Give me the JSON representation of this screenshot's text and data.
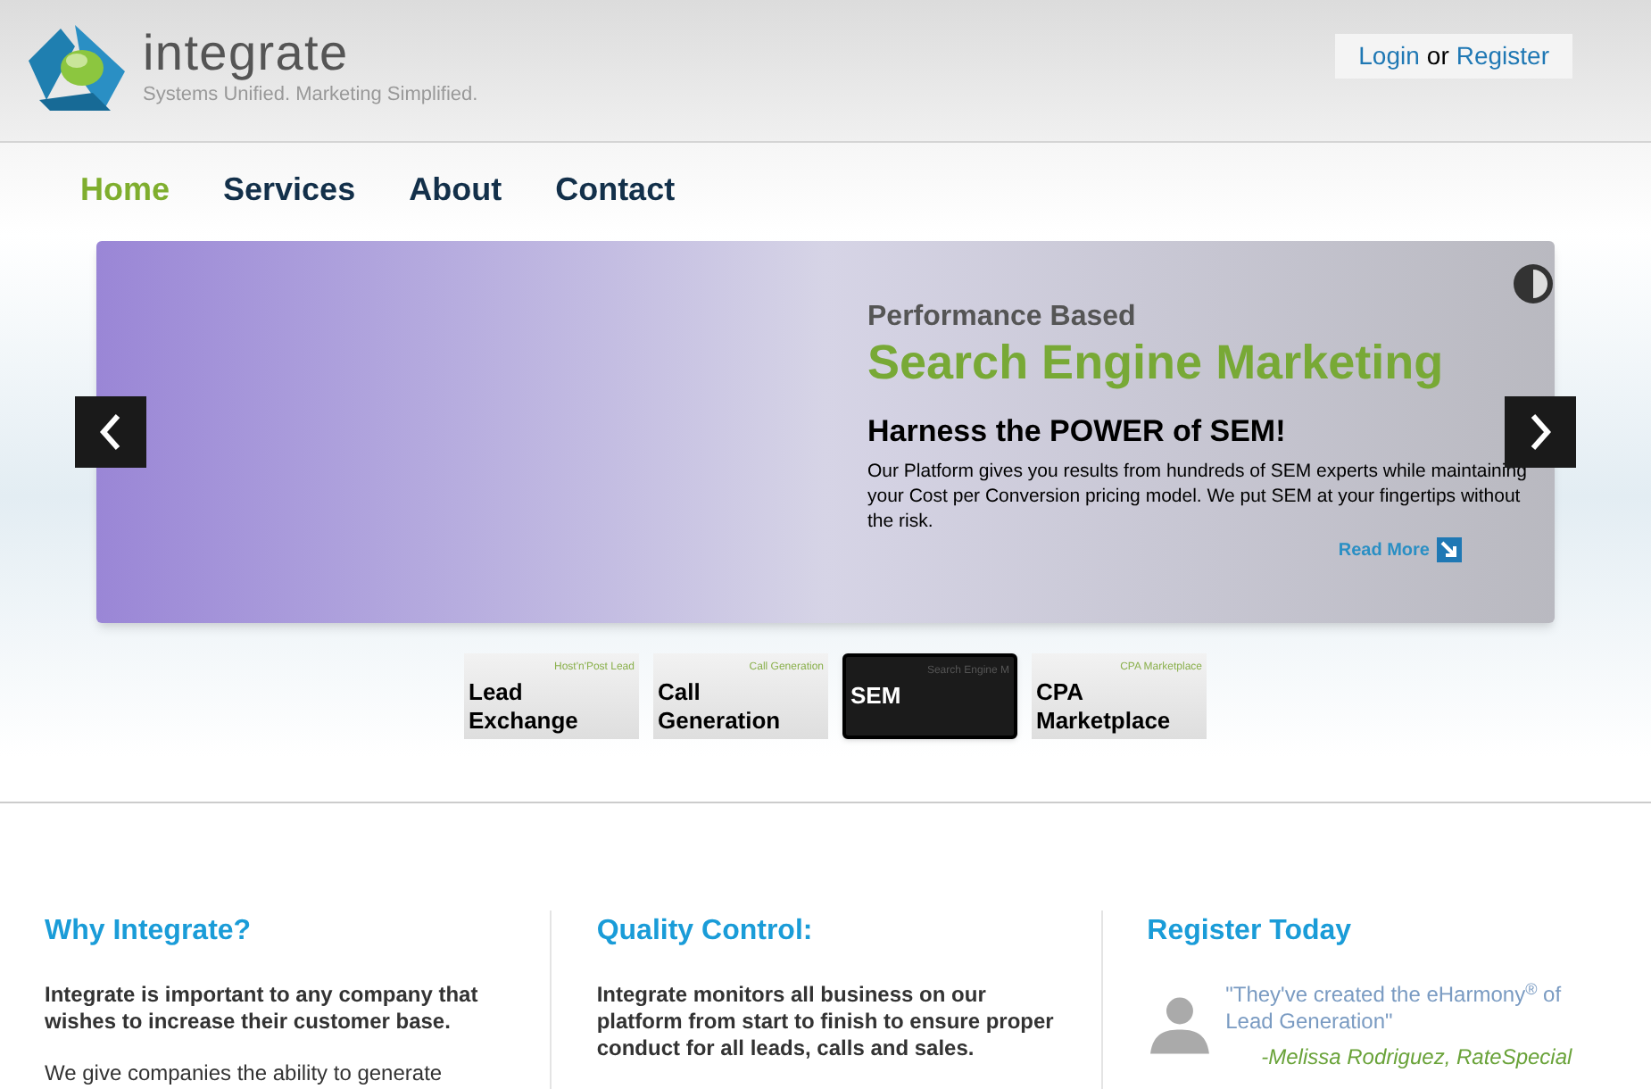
{
  "logo": {
    "name": "integrate",
    "tagline": "Systems Unified. Marketing Simplified."
  },
  "auth": {
    "login": "Login",
    "separator": "or",
    "register": "Register"
  },
  "nav": [
    {
      "label": "Home",
      "selected": true
    },
    {
      "label": "Services",
      "selected": false
    },
    {
      "label": "About",
      "selected": false
    },
    {
      "label": "Contact",
      "selected": false
    }
  ],
  "slide": {
    "kicker": "Performance Based",
    "title": "Search Engine Marketing",
    "heading": "Harness the POWER of SEM!",
    "body": "Our Platform gives you results from hundreds of SEM experts while maintaining your Cost per Conversion pricing model. We put SEM at your fingertips without the risk.",
    "link": "Read More"
  },
  "thumbnails": [
    {
      "label": "Lead Exchange",
      "subtitle": "Host'n'Post Lead",
      "selected": false
    },
    {
      "label": "Call Generation",
      "subtitle": "Call Generation",
      "selected": false
    },
    {
      "label": "SEM",
      "subtitle": "Search Engine M",
      "selected": true
    },
    {
      "label": "CPA Marketplace",
      "subtitle": "CPA Marketplace",
      "selected": false
    }
  ],
  "columns": [
    {
      "kind": "text",
      "title": "Why Integrate?",
      "paragraphs": [
        "Integrate is important to any company that wishes to increase their customer base.",
        "We give companies the ability to generate"
      ]
    },
    {
      "kind": "text",
      "title": "Quality Control:",
      "paragraphs": [
        "Integrate monitors all business on our platform from start to finish to ensure proper conduct for all leads, calls and sales."
      ]
    },
    {
      "kind": "testimonial",
      "title": "Register Today",
      "quote": "\"They've created the eHarmony$^{®}$ of Lead Generation\"",
      "author": "-Melissa Rodriguez, RateSpecial"
    }
  ]
}
